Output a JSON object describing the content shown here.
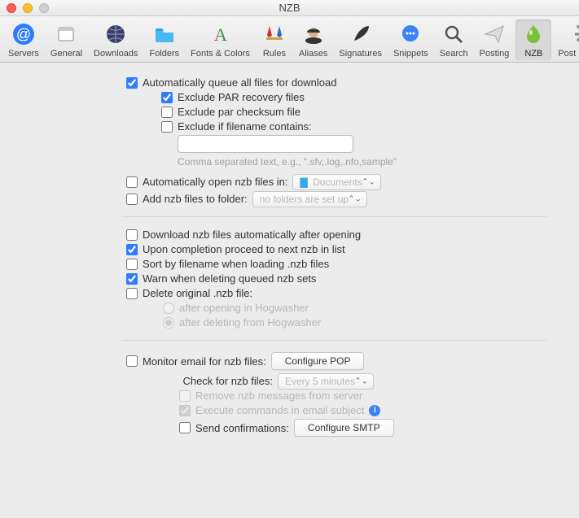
{
  "window": {
    "title": "NZB"
  },
  "toolbar": [
    {
      "name": "servers",
      "label": "Servers",
      "icon": "at"
    },
    {
      "name": "general",
      "label": "General",
      "icon": "window"
    },
    {
      "name": "downloads",
      "label": "Downloads",
      "icon": "globe"
    },
    {
      "name": "folders",
      "label": "Folders",
      "icon": "folder"
    },
    {
      "name": "fonts",
      "label": "Fonts & Colors",
      "icon": "fonts"
    },
    {
      "name": "rules",
      "label": "Rules",
      "icon": "rules"
    },
    {
      "name": "aliases",
      "label": "Aliases",
      "icon": "alias"
    },
    {
      "name": "signatures",
      "label": "Signatures",
      "icon": "feather"
    },
    {
      "name": "snippets",
      "label": "Snippets",
      "icon": "chat"
    },
    {
      "name": "search",
      "label": "Search",
      "icon": "search"
    },
    {
      "name": "posting",
      "label": "Posting",
      "icon": "plane"
    },
    {
      "name": "nzb",
      "label": "NZB",
      "icon": "drop",
      "selected": true
    },
    {
      "name": "postprocess",
      "label": "Post Process",
      "icon": "gear"
    }
  ],
  "section_download": {
    "auto_queue": {
      "checked": true,
      "label": "Automatically queue all files for download"
    },
    "ex_par": {
      "checked": true,
      "label": "Exclude PAR recovery files"
    },
    "ex_checksum": {
      "checked": false,
      "label": "Exclude par checksum file"
    },
    "ex_contains": {
      "checked": false,
      "label": "Exclude if filename contains:"
    },
    "contains_value": "",
    "contains_hint": "Comma separated text, e.g., \".sfv,.log,.nfo,sample\"",
    "auto_open": {
      "checked": false,
      "label": "Automatically open nzb files in:"
    },
    "open_in_value": "Documents",
    "add_folder": {
      "checked": false,
      "label": "Add nzb files to folder:"
    },
    "add_folder_value": "no folders are set up"
  },
  "section_processing": {
    "dl_auto": {
      "checked": false,
      "label": "Download nzb files automatically after opening"
    },
    "proceed": {
      "checked": true,
      "label": "Upon completion proceed to next nzb in list"
    },
    "sort": {
      "checked": false,
      "label": "Sort by filename when loading .nzb files"
    },
    "warn_del": {
      "checked": true,
      "label": "Warn when deleting queued nzb sets"
    },
    "del_orig": {
      "checked": false,
      "label": "Delete original .nzb file:"
    },
    "del_after_open": {
      "label": "after opening in Hogwasher"
    },
    "del_after_delete": {
      "label": "after deleting from Hogwasher"
    }
  },
  "section_email": {
    "monitor": {
      "checked": false,
      "label": "Monitor email for nzb files:"
    },
    "configure_pop": "Configure POP",
    "check_label": "Check for nzb files:",
    "check_value": "Every 5 minutes",
    "remove": {
      "checked": false,
      "label": "Remove nzb messages from server"
    },
    "execute": {
      "checked": true,
      "label": "Execute commands in email subject"
    },
    "send": {
      "checked": false,
      "label": "Send confirmations:"
    },
    "configure_smtp": "Configure SMTP"
  }
}
